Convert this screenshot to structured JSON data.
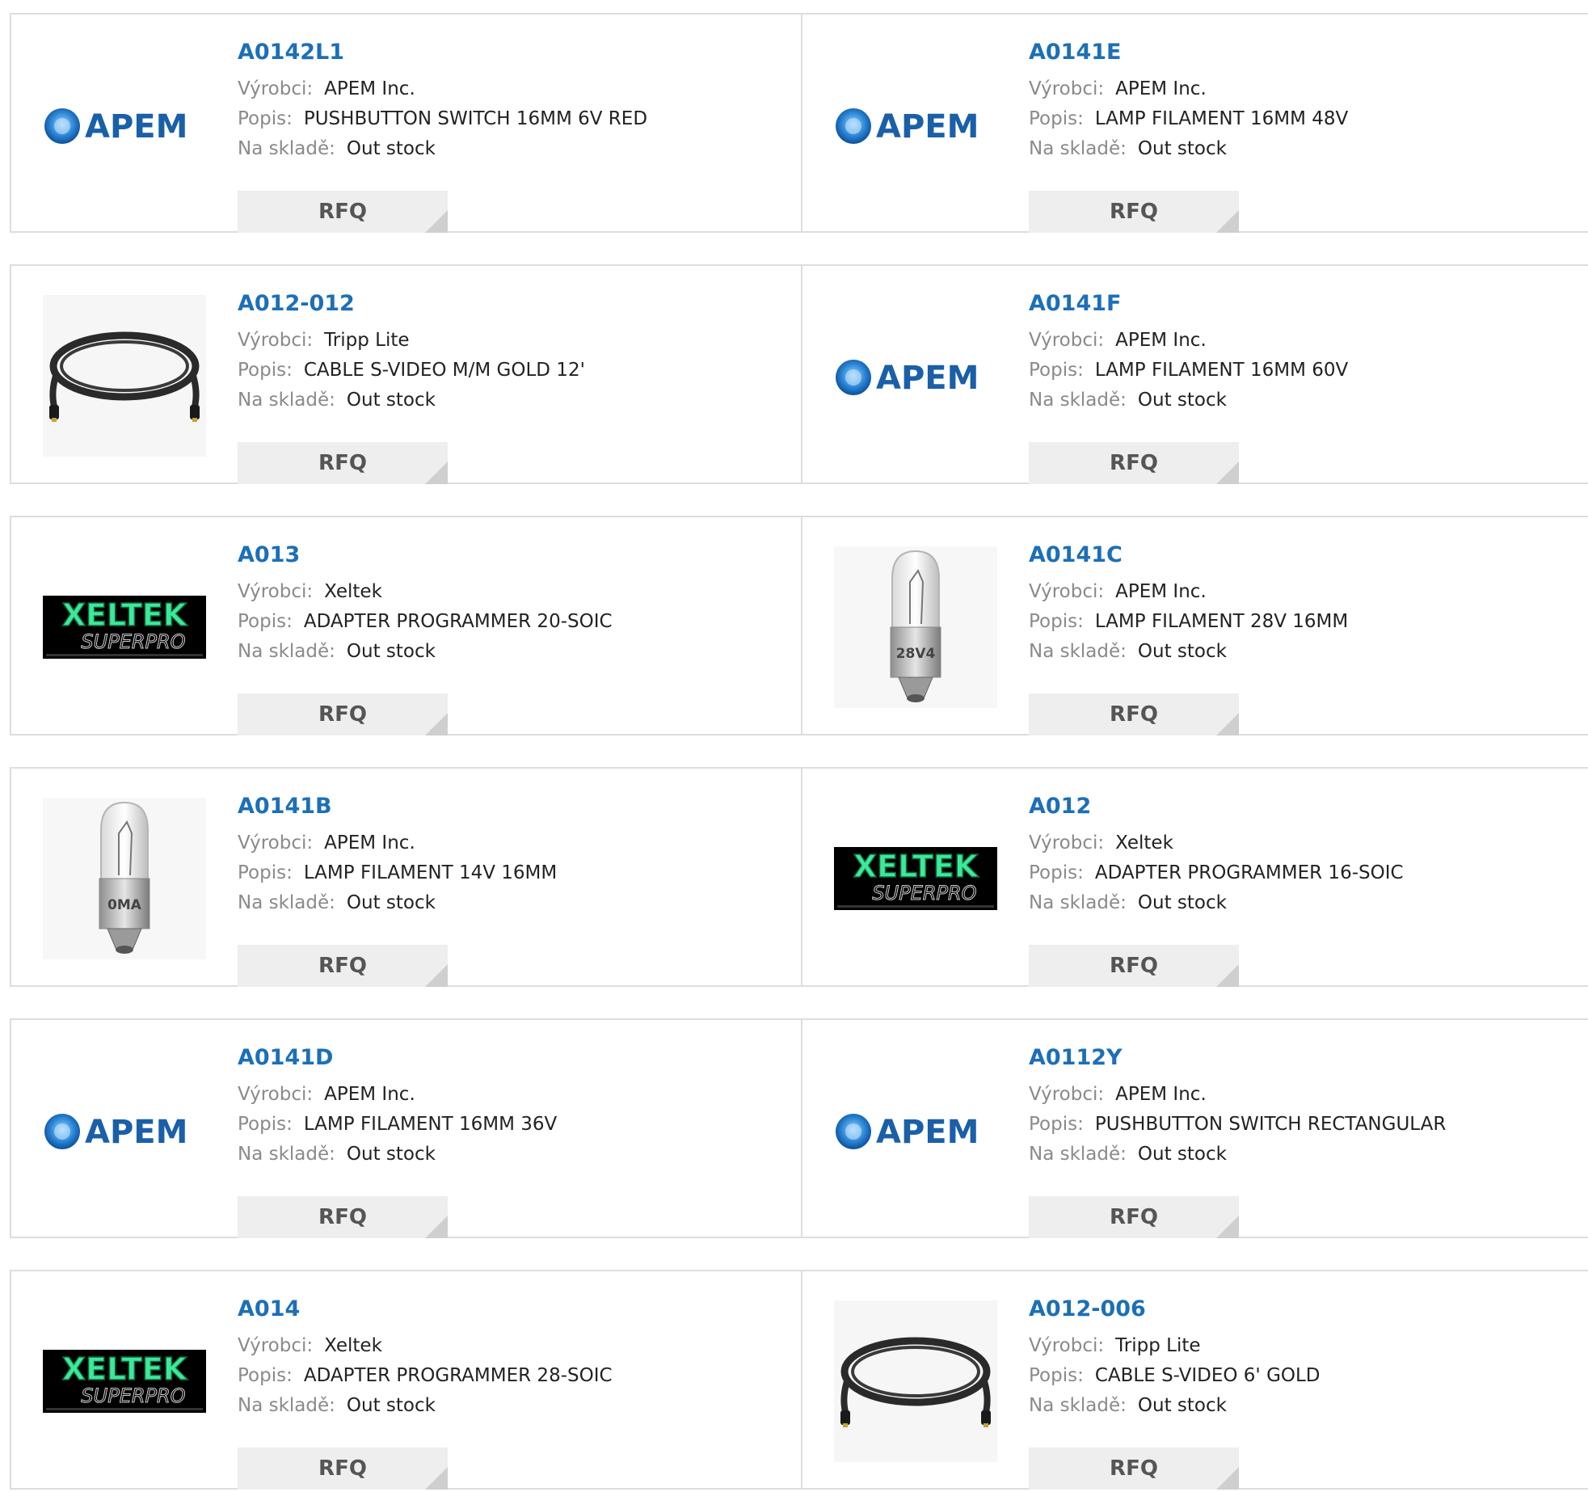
{
  "labels": {
    "manufacturer": "Výrobci:",
    "description": "Popis:",
    "stock": "Na skladě:",
    "rfq": "RFQ"
  },
  "colors": {
    "part_link": "#1c6fb8",
    "label_gray": "#8a8a8a",
    "border": "#dddddd",
    "button_bg": "#eeeeee",
    "apem_blue": "#1a5fa8",
    "xeltek_green": "#3ee89a"
  },
  "products": [
    {
      "part": "A0142L1",
      "manufacturer": "APEM Inc.",
      "description": "PUSHBUTTON SWITCH 16MM 6V RED",
      "stock": "Out stock",
      "image": "apem-logo",
      "image_text": "APEM"
    },
    {
      "part": "A0141E",
      "manufacturer": "APEM Inc.",
      "description": "LAMP FILAMENT 16MM 48V",
      "stock": "Out stock",
      "image": "apem-logo",
      "image_text": "APEM"
    },
    {
      "part": "A012-012",
      "manufacturer": "Tripp Lite",
      "description": "CABLE S-VIDEO M/M GOLD 12'",
      "stock": "Out stock",
      "image": "cable-photo"
    },
    {
      "part": "A0141F",
      "manufacturer": "APEM Inc.",
      "description": "LAMP FILAMENT 16MM 60V",
      "stock": "Out stock",
      "image": "apem-logo",
      "image_text": "APEM"
    },
    {
      "part": "A013",
      "manufacturer": "Xeltek",
      "description": "ADAPTER PROGRAMMER 20-SOIC",
      "stock": "Out stock",
      "image": "xeltek-logo",
      "image_text": "XELTEK",
      "image_subtext": "SUPERPRO"
    },
    {
      "part": "A0141C",
      "manufacturer": "APEM Inc.",
      "description": "LAMP FILAMENT 28V 16MM",
      "stock": "Out stock",
      "image": "lamp-photo",
      "image_text": "28V4"
    },
    {
      "part": "A0141B",
      "manufacturer": "APEM Inc.",
      "description": "LAMP FILAMENT 14V 16MM",
      "stock": "Out stock",
      "image": "lamp-photo",
      "image_text": "0MA"
    },
    {
      "part": "A012",
      "manufacturer": "Xeltek",
      "description": "ADAPTER PROGRAMMER 16-SOIC",
      "stock": "Out stock",
      "image": "xeltek-logo",
      "image_text": "XELTEK",
      "image_subtext": "SUPERPRO"
    },
    {
      "part": "A0141D",
      "manufacturer": "APEM Inc.",
      "description": "LAMP FILAMENT 16MM 36V",
      "stock": "Out stock",
      "image": "apem-logo",
      "image_text": "APEM"
    },
    {
      "part": "A0112Y",
      "manufacturer": "APEM Inc.",
      "description": "PUSHBUTTON SWITCH RECTANGULAR",
      "stock": "Out stock",
      "image": "apem-logo",
      "image_text": "APEM"
    },
    {
      "part": "A014",
      "manufacturer": "Xeltek",
      "description": "ADAPTER PROGRAMMER 28-SOIC",
      "stock": "Out stock",
      "image": "xeltek-logo",
      "image_text": "XELTEK",
      "image_subtext": "SUPERPRO"
    },
    {
      "part": "A012-006",
      "manufacturer": "Tripp Lite",
      "description": "CABLE S-VIDEO 6' GOLD",
      "stock": "Out stock",
      "image": "cable-photo"
    }
  ]
}
